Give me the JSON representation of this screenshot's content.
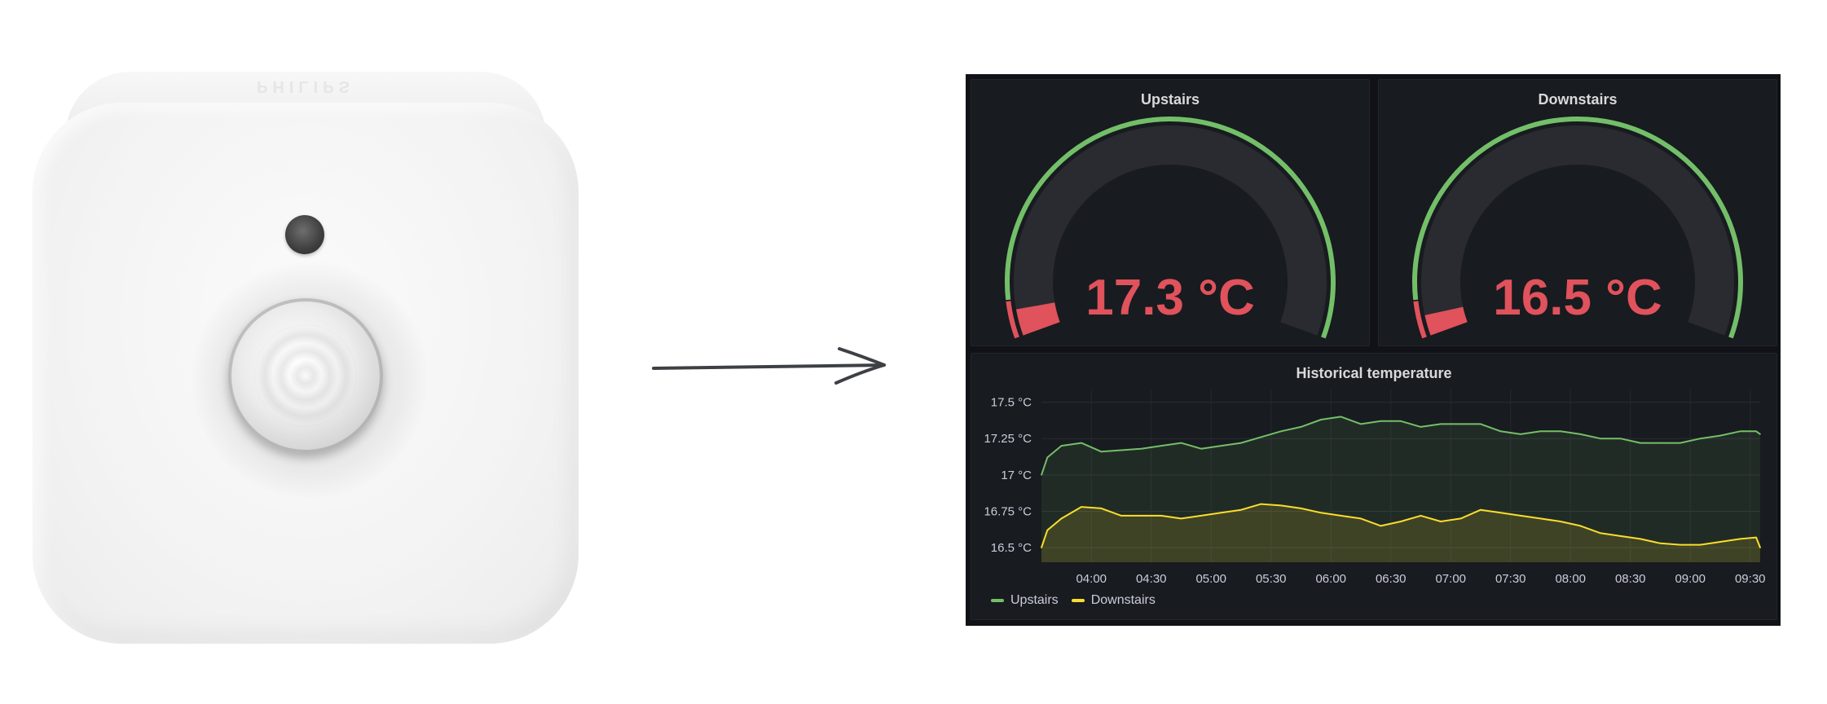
{
  "sensor": {
    "brand": "PHILIPS"
  },
  "dashboard": {
    "gauges": [
      {
        "title": "Upstairs",
        "value": 17.3,
        "display": "17.3 °C",
        "fraction": 0.045,
        "threshold_fraction": 0.06
      },
      {
        "title": "Downstairs",
        "value": 16.5,
        "display": "16.5 °C",
        "fraction": 0.035,
        "threshold_fraction": 0.06
      }
    ],
    "colors": {
      "ok": "#73bf69",
      "alert": "#e0525c",
      "track": "#2a2b30",
      "upstairs": "#73bf69",
      "downstairs": "#fade2a"
    },
    "chart": {
      "title": "Historical temperature"
    }
  },
  "chart_data": {
    "type": "line",
    "title": "Historical temperature",
    "xlabel": "",
    "ylabel": "",
    "x_range": [
      "03:35",
      "09:35"
    ],
    "x_ticks": [
      "04:00",
      "04:30",
      "05:00",
      "05:30",
      "06:00",
      "06:30",
      "07:00",
      "07:30",
      "08:00",
      "08:30",
      "09:00",
      "09:30"
    ],
    "y_ticks": [
      "17.5 °C",
      "17.25 °C",
      "17 °C",
      "16.75 °C",
      "16.5 °C"
    ],
    "ylim": [
      16.4,
      17.52
    ],
    "grid": true,
    "legend_position": "bottom-left",
    "series": [
      {
        "name": "Upstairs",
        "x": [
          "03:35",
          "03:38",
          "03:45",
          "03:55",
          "04:05",
          "04:15",
          "04:25",
          "04:35",
          "04:45",
          "04:55",
          "05:05",
          "05:15",
          "05:25",
          "05:35",
          "05:45",
          "05:55",
          "06:05",
          "06:15",
          "06:25",
          "06:35",
          "06:45",
          "06:55",
          "07:05",
          "07:15",
          "07:25",
          "07:35",
          "07:45",
          "07:55",
          "08:05",
          "08:15",
          "08:25",
          "08:35",
          "08:45",
          "08:55",
          "09:05",
          "09:15",
          "09:25",
          "09:33",
          "09:35"
        ],
        "values": [
          17.0,
          17.12,
          17.2,
          17.22,
          17.16,
          17.17,
          17.18,
          17.2,
          17.22,
          17.18,
          17.2,
          17.22,
          17.26,
          17.3,
          17.33,
          17.38,
          17.4,
          17.35,
          17.37,
          17.37,
          17.33,
          17.35,
          17.35,
          17.35,
          17.3,
          17.28,
          17.3,
          17.3,
          17.28,
          17.25,
          17.25,
          17.22,
          17.22,
          17.22,
          17.25,
          17.27,
          17.3,
          17.3,
          17.28
        ]
      },
      {
        "name": "Downstairs",
        "x": [
          "03:35",
          "03:38",
          "03:45",
          "03:55",
          "04:05",
          "04:15",
          "04:25",
          "04:35",
          "04:45",
          "04:55",
          "05:05",
          "05:15",
          "05:25",
          "05:35",
          "05:45",
          "05:55",
          "06:05",
          "06:15",
          "06:25",
          "06:35",
          "06:45",
          "06:55",
          "07:05",
          "07:15",
          "07:25",
          "07:35",
          "07:45",
          "07:55",
          "08:05",
          "08:15",
          "08:25",
          "08:35",
          "08:45",
          "08:55",
          "09:05",
          "09:15",
          "09:25",
          "09:33",
          "09:35"
        ],
        "values": [
          16.5,
          16.62,
          16.7,
          16.78,
          16.77,
          16.72,
          16.72,
          16.72,
          16.7,
          16.72,
          16.74,
          16.76,
          16.8,
          16.79,
          16.77,
          16.74,
          16.72,
          16.7,
          16.65,
          16.68,
          16.72,
          16.68,
          16.7,
          16.76,
          16.74,
          16.72,
          16.7,
          16.68,
          16.65,
          16.6,
          16.58,
          16.56,
          16.53,
          16.52,
          16.52,
          16.54,
          16.56,
          16.57,
          16.5
        ]
      }
    ]
  }
}
